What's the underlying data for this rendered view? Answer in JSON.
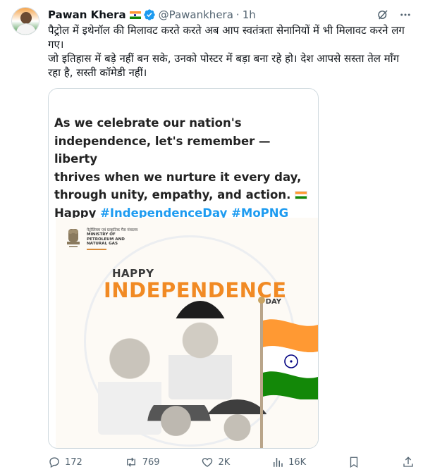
{
  "tweet": {
    "author_name": "Pawan Khera",
    "handle": "@Pawankhera",
    "separator": "·",
    "time": "1h",
    "text_line1": "पैट्रोल में इथेनॉल की मिलावट करते करते अब आप स्वतंत्रता सेनानियों में भी मिलावट करने लग गए।",
    "text_line2": "जो इतिहास में बड़े नहीं बन सके, उनको पोस्टर में बड़ा बना रहे हो। देश आपसे सस्ता तेल माँग रहा है, सस्ती कॉमेडी नहीं।"
  },
  "icons": {
    "verified": "verified-badge-icon",
    "grok": "grok-icon",
    "more": "more-icon",
    "reply": "reply-icon",
    "retweet": "retweet-icon",
    "like": "like-icon",
    "views": "views-icon",
    "bookmark": "bookmark-icon",
    "share": "share-icon"
  },
  "media": {
    "caption_line1": "As we celebrate our nation's",
    "caption_line2": "independence, let's remember — liberty",
    "caption_line3": "thrives when we nurture it every day,",
    "caption_line4": "through unity, empathy, and action.",
    "caption_happy": "Happy",
    "caption_hashtags": "#IndependenceDay #MoPNG",
    "poster": {
      "org_hindi": "पेट्रोलियम एवं प्राकृतिक गैस मंत्रालय",
      "org_line1": "MINISTRY OF",
      "org_line2": "PETROLEUM AND",
      "org_line3": "NATURAL GAS",
      "happy": "HAPPY",
      "independence": "INDEPENDENCE",
      "day": "DAY"
    }
  },
  "actions": {
    "replies": "172",
    "retweets": "769",
    "likes": "2K",
    "views": "16K"
  },
  "colors": {
    "accent": "#1d9bf0",
    "muted": "#536471",
    "saffron": "#ff9933",
    "green": "#138808",
    "poster_orange": "#f18a24"
  }
}
